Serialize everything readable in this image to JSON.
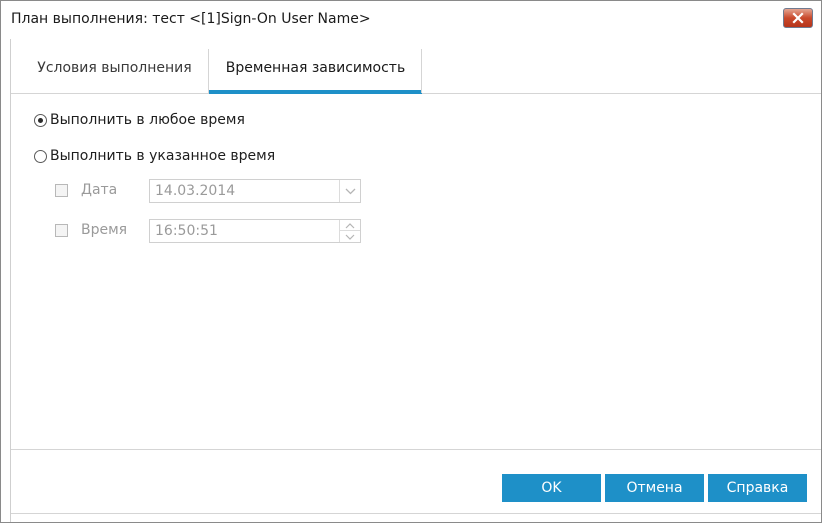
{
  "window": {
    "title": "План выполнения: тест <[1]Sign-On User Name>",
    "close_icon": "close-icon",
    "accent_color": "#1e90c8"
  },
  "tabs": [
    {
      "label": "Условия выполнения",
      "active": false
    },
    {
      "label": "Временная зависимость",
      "active": true
    }
  ],
  "options": {
    "any_time": {
      "label": "Выполнить в любое время",
      "selected": true
    },
    "specified_time": {
      "label": "Выполнить в указанное время",
      "selected": false
    }
  },
  "fields": {
    "date": {
      "label": "Дата",
      "value": "14.03.2014",
      "checked": false,
      "enabled": false
    },
    "time": {
      "label": "Время",
      "value": "16:50:51",
      "checked": false,
      "enabled": false
    }
  },
  "buttons": {
    "ok": "OK",
    "cancel": "Отмена",
    "help": "Справка"
  }
}
